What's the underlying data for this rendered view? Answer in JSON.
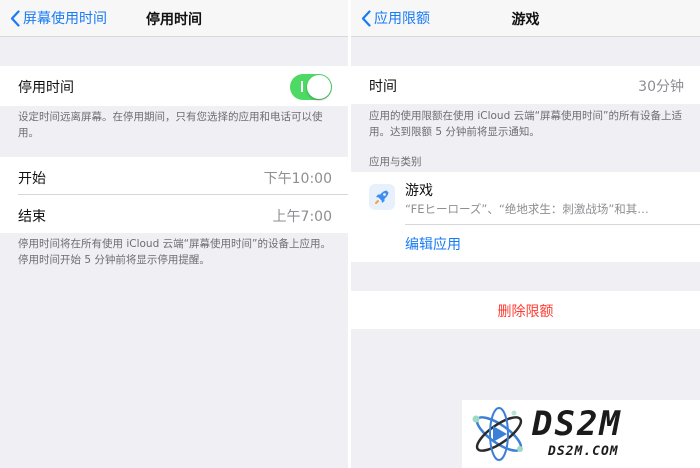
{
  "left": {
    "nav": {
      "back_label": "屏幕使用时间",
      "title": "停用时间"
    },
    "downtime_toggle": {
      "label": "停用时间",
      "on": true
    },
    "toggle_desc": "设定时间远离屏幕。在停用期间，只有您选择的应用和电话可以使用。",
    "start": {
      "label": "开始",
      "value": "下午10:00"
    },
    "end": {
      "label": "结束",
      "value": "上午7:00"
    },
    "footer": "停用时间将在所有使用 iCloud 云端“屏幕使用时间”的设备上应用。停用时间开始 5 分钟前将显示停用提醒。"
  },
  "right": {
    "nav": {
      "back_label": "应用限额",
      "title": "游戏"
    },
    "time": {
      "label": "时间",
      "value": "30分钟"
    },
    "time_desc": "应用的使用限额在使用 iCloud 云端“屏幕使用时间”的所有设备上适用。达到限额 5 分钟前将显示通知。",
    "section_header": "应用与类别",
    "category": {
      "title": "游戏",
      "subtitle": "“FEヒーローズ”、“绝地求生：刺激战场”和其…",
      "icon": "rocket-icon"
    },
    "edit_apps": "编辑应用",
    "delete_limit": "删除限额"
  },
  "watermark": {
    "big": "DS2M",
    "small": "DS2M.COM"
  },
  "colors": {
    "accent": "#1a7bf5",
    "toggle_on": "#4cd964",
    "destructive": "#ff3b30"
  }
}
